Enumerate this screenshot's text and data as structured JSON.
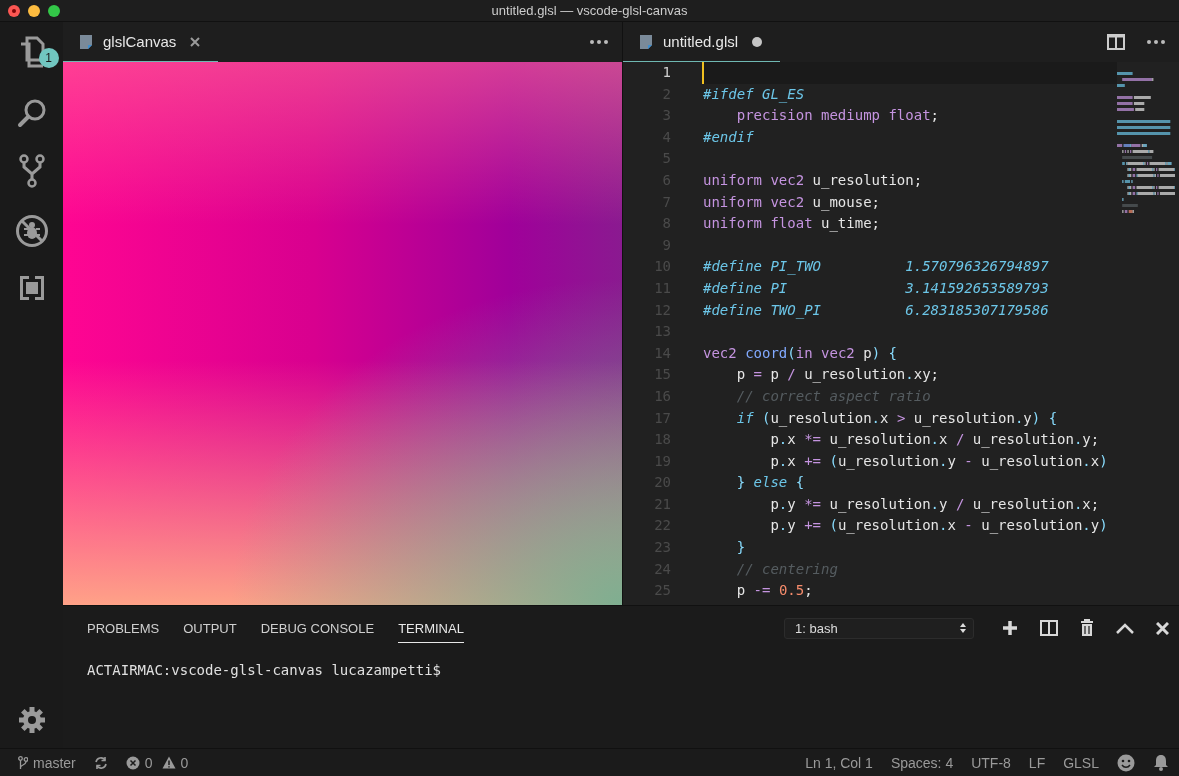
{
  "window": {
    "title": "untitled.glsl — vscode-glsl-canvas"
  },
  "activity_bar": {
    "explorer_badge": "1"
  },
  "preview_group": {
    "tab": {
      "label": "glslCanvas",
      "selected": true,
      "dirty": false
    }
  },
  "editor": {
    "tab": {
      "label": "untitled.glsl",
      "selected": true,
      "dirty": true
    },
    "lines": [
      {
        "number": "1",
        "current": true
      },
      {
        "number": "2",
        "current": false,
        "tokens": [
          {
            "kind": "pp",
            "text": "#ifdef GL_ES"
          }
        ]
      },
      {
        "number": "3",
        "current": false,
        "tokens": [
          {
            "kind": "kw",
            "text": "    precision mediump float"
          },
          {
            "kind": "id",
            "text": ";"
          }
        ]
      },
      {
        "number": "4",
        "current": false,
        "tokens": [
          {
            "kind": "pp",
            "text": "#endif"
          }
        ]
      },
      {
        "number": "5",
        "current": false
      },
      {
        "number": "6",
        "current": false,
        "tokens": [
          {
            "kind": "kw",
            "text": "uniform vec2 "
          },
          {
            "kind": "id",
            "text": "u_resolution;"
          }
        ]
      },
      {
        "number": "7",
        "current": false,
        "tokens": [
          {
            "kind": "kw",
            "text": "uniform vec2 "
          },
          {
            "kind": "id",
            "text": "u_mouse;"
          }
        ]
      },
      {
        "number": "8",
        "current": false,
        "tokens": [
          {
            "kind": "kw",
            "text": "uniform float "
          },
          {
            "kind": "id",
            "text": "u_time;"
          }
        ]
      },
      {
        "number": "9",
        "current": false
      },
      {
        "number": "10",
        "current": false,
        "tokens": [
          {
            "kind": "pp",
            "text": "#define PI_TWO          1.570796326794897"
          }
        ]
      },
      {
        "number": "11",
        "current": false,
        "tokens": [
          {
            "kind": "pp",
            "text": "#define PI              3.141592653589793"
          }
        ]
      },
      {
        "number": "12",
        "current": false,
        "tokens": [
          {
            "kind": "pp",
            "text": "#define TWO_PI          6.283185307179586"
          }
        ]
      },
      {
        "number": "13",
        "current": false
      },
      {
        "number": "14",
        "current": false,
        "tokens": [
          {
            "kind": "kw",
            "text": "vec2 "
          },
          {
            "kind": "fn",
            "text": "coord"
          },
          {
            "kind": "pu",
            "text": "("
          },
          {
            "kind": "kw",
            "text": "in vec2 "
          },
          {
            "kind": "id",
            "text": "p"
          },
          {
            "kind": "pu",
            "text": ") {"
          }
        ]
      },
      {
        "number": "15",
        "current": false,
        "tokens": [
          {
            "kind": "id",
            "text": "    p "
          },
          {
            "kind": "kw",
            "text": "= "
          },
          {
            "kind": "id",
            "text": "p "
          },
          {
            "kind": "kw",
            "text": "/ "
          },
          {
            "kind": "id",
            "text": "u_resolution"
          },
          {
            "kind": "pu",
            "text": "."
          },
          {
            "kind": "id",
            "text": "xy;"
          }
        ]
      },
      {
        "number": "16",
        "current": false,
        "tokens": [
          {
            "kind": "cm",
            "text": "    // correct aspect ratio"
          }
        ]
      },
      {
        "number": "17",
        "current": false,
        "tokens": [
          {
            "kind": "pp",
            "text": "    if"
          },
          {
            "kind": "pu",
            "text": " ("
          },
          {
            "kind": "id",
            "text": "u_resolution"
          },
          {
            "kind": "pu",
            "text": "."
          },
          {
            "kind": "id",
            "text": "x "
          },
          {
            "kind": "kw",
            "text": "> "
          },
          {
            "kind": "id",
            "text": "u_resolution"
          },
          {
            "kind": "pu",
            "text": "."
          },
          {
            "kind": "id",
            "text": "y"
          },
          {
            "kind": "pu",
            "text": ") {"
          }
        ]
      },
      {
        "number": "18",
        "current": false,
        "tokens": [
          {
            "kind": "id",
            "text": "        p"
          },
          {
            "kind": "pu",
            "text": "."
          },
          {
            "kind": "id",
            "text": "x "
          },
          {
            "kind": "kw",
            "text": "*= "
          },
          {
            "kind": "id",
            "text": "u_resolution"
          },
          {
            "kind": "pu",
            "text": "."
          },
          {
            "kind": "id",
            "text": "x "
          },
          {
            "kind": "kw",
            "text": "/ "
          },
          {
            "kind": "id",
            "text": "u_resolution"
          },
          {
            "kind": "pu",
            "text": "."
          },
          {
            "kind": "id",
            "text": "y;"
          }
        ]
      },
      {
        "number": "19",
        "current": false,
        "tokens": [
          {
            "kind": "id",
            "text": "        p"
          },
          {
            "kind": "pu",
            "text": "."
          },
          {
            "kind": "id",
            "text": "x "
          },
          {
            "kind": "kw",
            "text": "+= "
          },
          {
            "kind": "pu",
            "text": "("
          },
          {
            "kind": "id",
            "text": "u_resolution"
          },
          {
            "kind": "pu",
            "text": "."
          },
          {
            "kind": "id",
            "text": "y "
          },
          {
            "kind": "kw",
            "text": "- "
          },
          {
            "kind": "id",
            "text": "u_resolution"
          },
          {
            "kind": "pu",
            "text": "."
          },
          {
            "kind": "id",
            "text": "x"
          },
          {
            "kind": "pu",
            "text": ")"
          }
        ]
      },
      {
        "number": "20",
        "current": false,
        "tokens": [
          {
            "kind": "pu",
            "text": "    } "
          },
          {
            "kind": "pp",
            "text": "else"
          },
          {
            "kind": "pu",
            "text": " {"
          }
        ]
      },
      {
        "number": "21",
        "current": false,
        "tokens": [
          {
            "kind": "id",
            "text": "        p"
          },
          {
            "kind": "pu",
            "text": "."
          },
          {
            "kind": "id",
            "text": "y "
          },
          {
            "kind": "kw",
            "text": "*= "
          },
          {
            "kind": "id",
            "text": "u_resolution"
          },
          {
            "kind": "pu",
            "text": "."
          },
          {
            "kind": "id",
            "text": "y "
          },
          {
            "kind": "kw",
            "text": "/ "
          },
          {
            "kind": "id",
            "text": "u_resolution"
          },
          {
            "kind": "pu",
            "text": "."
          },
          {
            "kind": "id",
            "text": "x;"
          }
        ]
      },
      {
        "number": "22",
        "current": false,
        "tokens": [
          {
            "kind": "id",
            "text": "        p"
          },
          {
            "kind": "pu",
            "text": "."
          },
          {
            "kind": "id",
            "text": "y "
          },
          {
            "kind": "kw",
            "text": "+= "
          },
          {
            "kind": "pu",
            "text": "("
          },
          {
            "kind": "id",
            "text": "u_resolution"
          },
          {
            "kind": "pu",
            "text": "."
          },
          {
            "kind": "id",
            "text": "x "
          },
          {
            "kind": "kw",
            "text": "- "
          },
          {
            "kind": "id",
            "text": "u_resolution"
          },
          {
            "kind": "pu",
            "text": "."
          },
          {
            "kind": "id",
            "text": "y"
          },
          {
            "kind": "pu",
            "text": ")"
          }
        ]
      },
      {
        "number": "23",
        "current": false,
        "tokens": [
          {
            "kind": "pu",
            "text": "    }"
          }
        ]
      },
      {
        "number": "24",
        "current": false,
        "tokens": [
          {
            "kind": "cm",
            "text": "    // centering"
          }
        ]
      },
      {
        "number": "25",
        "current": false,
        "tokens": [
          {
            "kind": "id",
            "text": "    p "
          },
          {
            "kind": "kw",
            "text": "-= "
          },
          {
            "kind": "num",
            "text": "0.5"
          },
          {
            "kind": "id",
            "text": ";"
          }
        ]
      }
    ]
  },
  "panel": {
    "tabs": [
      {
        "label": "PROBLEMS",
        "selected": false
      },
      {
        "label": "OUTPUT",
        "selected": false
      },
      {
        "label": "DEBUG CONSOLE",
        "selected": false
      },
      {
        "label": "TERMINAL",
        "selected": true
      }
    ],
    "terminal_picker": "1: bash",
    "terminal_text": "ACTAIRMAC:vscode-glsl-canvas lucazampetti$"
  },
  "status_bar": {
    "branch": "master",
    "errors": "0",
    "warnings": "0",
    "items": [
      "Ln 1, Col 1",
      "Spaces: 4",
      "UTF-8",
      "LF",
      "GLSL"
    ]
  }
}
